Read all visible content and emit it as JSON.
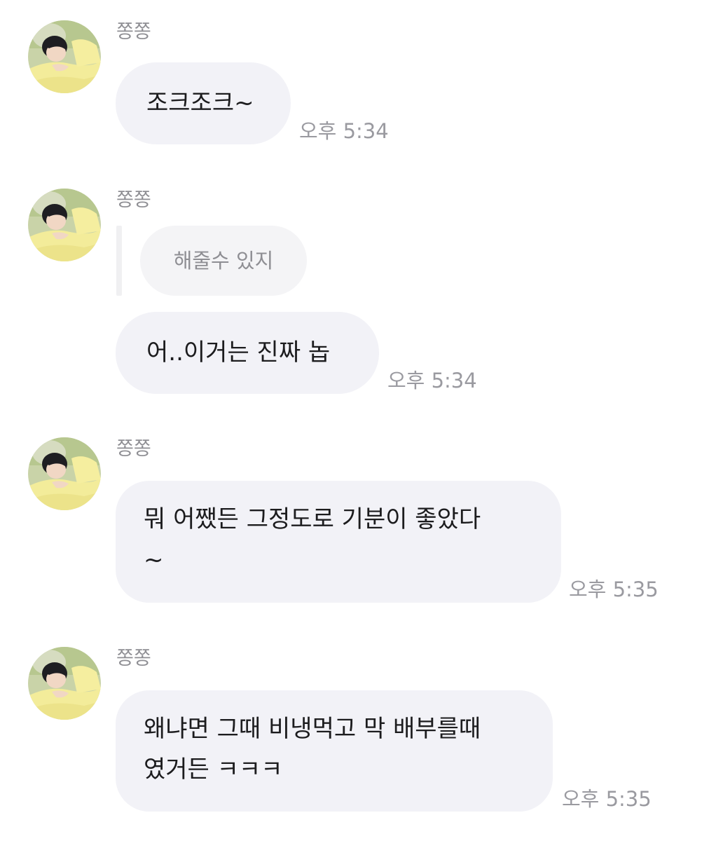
{
  "messages": [
    {
      "sender": "쫑쫑",
      "lines": [
        "조크조크~"
      ],
      "time": "오후 5:34"
    },
    {
      "sender": "쫑쫑",
      "reply_quote": "해줄수 있지",
      "lines": [
        "어..이거는 진짜 놉"
      ],
      "time": "오후 5:34"
    },
    {
      "sender": "쫑쫑",
      "lines": [
        "뭐 어쨌든 그정도로 기분이 좋았다",
        "~"
      ],
      "time": "오후 5:35"
    },
    {
      "sender": "쫑쫑",
      "lines": [
        "왜냐면 그때 비냉먹고 막 배부를때",
        "였거든 ㅋㅋㅋ"
      ],
      "time": "오후 5:35"
    }
  ],
  "colors": {
    "bubble": "#f2f2f7",
    "sender": "#8e8e93",
    "time": "#9a9aa0",
    "avatar_shirt": "#f3ec9a",
    "avatar_grass": "#b9c98f"
  },
  "icons": {
    "avatar": "profile-photo-avatar"
  }
}
